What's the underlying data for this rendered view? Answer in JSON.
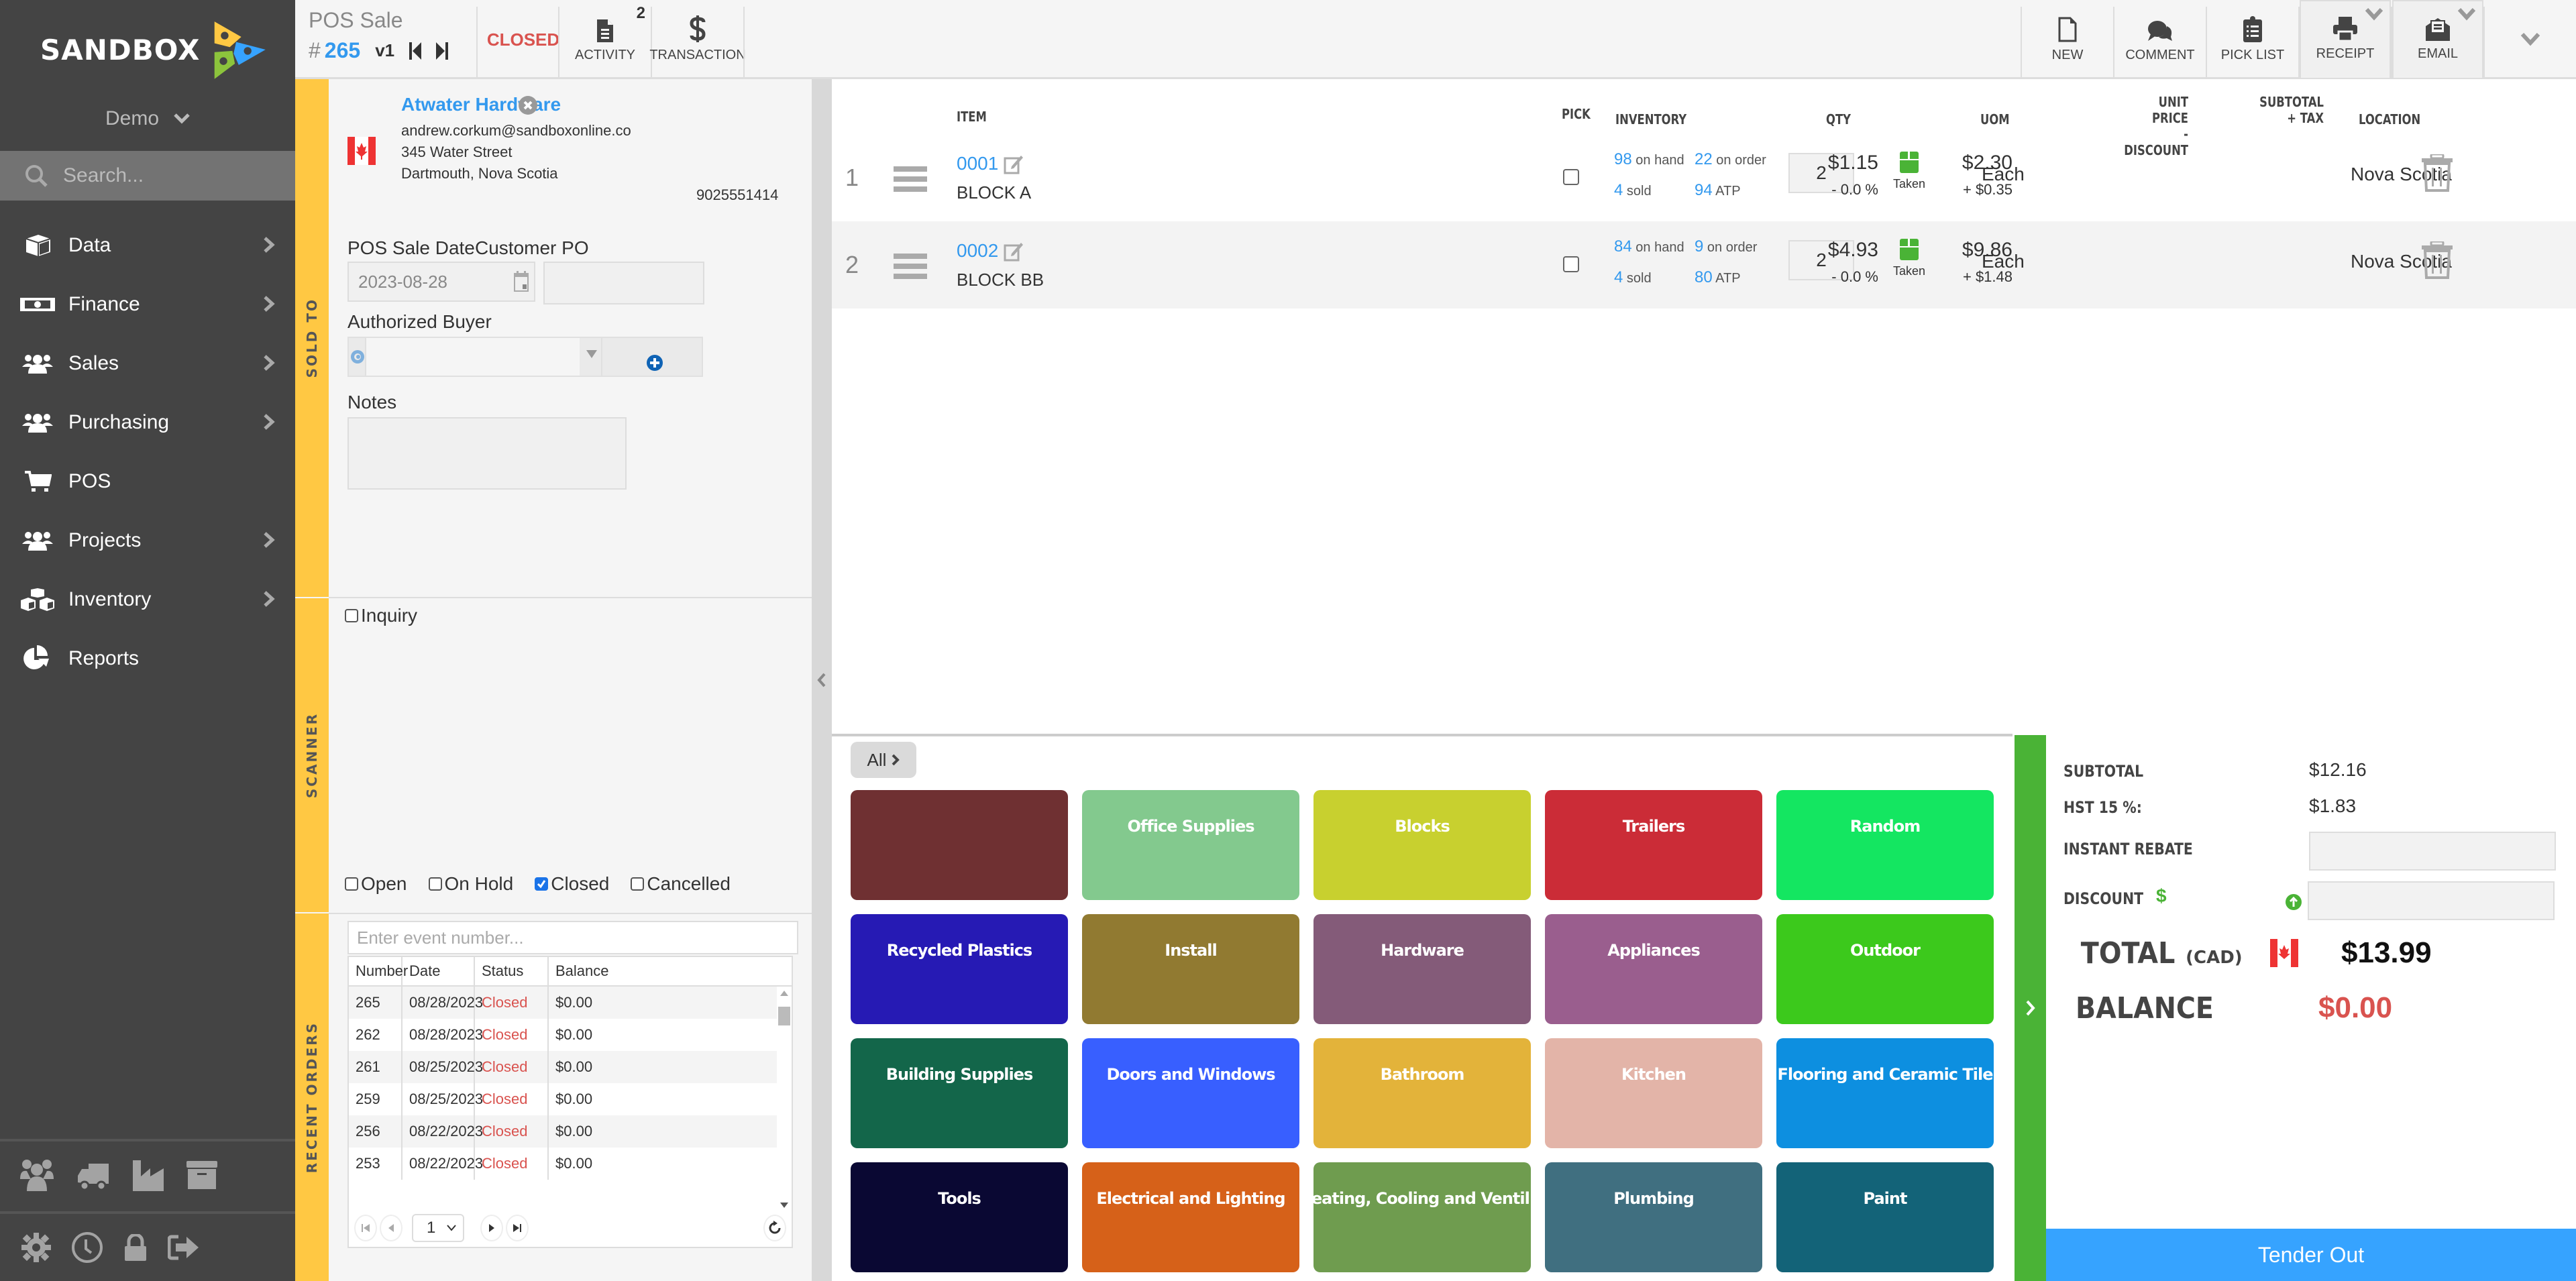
{
  "app": {
    "brand": "SANDBOX",
    "workspace": "Demo"
  },
  "sidebar": {
    "search_placeholder": "Search...",
    "items": [
      {
        "label": "Data",
        "icon": "cube-icon",
        "has_submenu": true
      },
      {
        "label": "Finance",
        "icon": "money-bill-icon",
        "has_submenu": true
      },
      {
        "label": "Sales",
        "icon": "users-icon",
        "has_submenu": true
      },
      {
        "label": "Purchasing",
        "icon": "users-icon",
        "has_submenu": true
      },
      {
        "label": "POS",
        "icon": "cart-icon",
        "has_submenu": false
      },
      {
        "label": "Projects",
        "icon": "users-icon",
        "has_submenu": true
      },
      {
        "label": "Inventory",
        "icon": "cubes-icon",
        "has_submenu": true
      },
      {
        "label": "Reports",
        "icon": "pie-chart-icon",
        "has_submenu": false
      }
    ],
    "tools": [
      "users-icon",
      "truck-icon",
      "factory-icon",
      "archive-icon"
    ],
    "system": [
      "gear-icon",
      "clock-icon",
      "lock-icon",
      "sign-out-icon"
    ]
  },
  "header": {
    "doc_type": "POS Sale",
    "hash": "#",
    "number": "265",
    "version": "v1",
    "status": "CLOSED",
    "buttons_left": [
      {
        "label": "ACTIVITY",
        "badge": "2",
        "icon": "document-icon"
      },
      {
        "label": "TRANSACTION",
        "icon": "dollar-icon"
      }
    ],
    "buttons_right": [
      {
        "label": "NEW",
        "icon": "new-file-icon"
      },
      {
        "label": "COMMENT",
        "icon": "comments-icon"
      },
      {
        "label": "PICK LIST",
        "icon": "clipboard-list-icon"
      },
      {
        "label": "RECEIPT",
        "icon": "printer-icon",
        "dropdown": true
      },
      {
        "label": "EMAIL",
        "icon": "envelope-open-icon",
        "dropdown": true
      }
    ]
  },
  "sold_to": {
    "tab_label": "SOLD TO",
    "customer_name": "Atwater Hardware",
    "email": "andrew.corkum@sandboxonline.co",
    "address1": "345 Water Street",
    "address2": "Dartmouth, Nova Scotia",
    "phone": "9025551414",
    "country_flag": "Canada",
    "sale_date_label": "POS Sale Date",
    "sale_date": "2023-08-28",
    "customer_po_label": "Customer PO",
    "customer_po": "",
    "authorized_buyer_label": "Authorized Buyer",
    "authorized_buyer": "",
    "notes_label": "Notes",
    "notes": ""
  },
  "scanner": {
    "tab_label": "SCANNER",
    "inquiry_label": "Inquiry",
    "inquiry_checked": false
  },
  "status_filters": [
    {
      "label": "Open",
      "checked": false
    },
    {
      "label": "On Hold",
      "checked": false
    },
    {
      "label": "Closed",
      "checked": true
    },
    {
      "label": "Cancelled",
      "checked": false
    }
  ],
  "recent_orders": {
    "tab_label": "RECENT ORDERS",
    "search_placeholder": "Enter event number...",
    "columns": [
      "Number",
      "Date",
      "Status",
      "Balance"
    ],
    "rows": [
      {
        "number": "265",
        "date": "08/28/2023",
        "status": "Closed",
        "balance": "$0.00"
      },
      {
        "number": "262",
        "date": "08/28/2023",
        "status": "Closed",
        "balance": "$0.00"
      },
      {
        "number": "261",
        "date": "08/25/2023",
        "status": "Closed",
        "balance": "$0.00"
      },
      {
        "number": "259",
        "date": "08/25/2023",
        "status": "Closed",
        "balance": "$0.00"
      },
      {
        "number": "256",
        "date": "08/22/2023",
        "status": "Closed",
        "balance": "$0.00"
      },
      {
        "number": "253",
        "date": "08/22/2023",
        "status": "Closed",
        "balance": "$0.00"
      }
    ],
    "page": "1"
  },
  "items_table": {
    "columns": {
      "item": "ITEM",
      "pick": "PICK",
      "inventory": "INVENTORY",
      "qty": "QTY",
      "uom": "UOM",
      "unit_price_1": "UNIT PRICE",
      "unit_price_2": "- DISCOUNT",
      "subtotal_1": "SUBTOTAL",
      "subtotal_2": "+ TAX",
      "location": "LOCATION"
    },
    "inv_labels": {
      "on_hand": "on hand",
      "on_order": "on order",
      "sold": "sold",
      "atp": "ATP"
    },
    "rows": [
      {
        "line": "1",
        "code": "0001",
        "desc": "BLOCK A",
        "on_hand": "98",
        "on_order": "22",
        "sold": "4",
        "atp": "94",
        "qty": "2",
        "pick_status": "Taken",
        "uom": "Each",
        "unit_price": "$1.15",
        "discount": "- 0.0 %",
        "subtotal": "$2.30",
        "tax": "+ $0.35",
        "location": "Nova Scotia"
      },
      {
        "line": "2",
        "code": "0002",
        "desc": "BLOCK BB",
        "on_hand": "84",
        "on_order": "9",
        "sold": "4",
        "atp": "80",
        "qty": "2",
        "pick_status": "Taken",
        "uom": "Each",
        "unit_price": "$4.93",
        "discount": "- 0.0 %",
        "subtotal": "$9.86",
        "tax": "+ $1.48",
        "location": "Nova Scotia"
      }
    ]
  },
  "categories": {
    "breadcrumb": "All",
    "tiles": [
      {
        "label": "",
        "color": "#6f3032"
      },
      {
        "label": "Office Supplies",
        "color": "#83c98e"
      },
      {
        "label": "Blocks",
        "color": "#c8d02f"
      },
      {
        "label": "Trailers",
        "color": "#cb2c37"
      },
      {
        "label": "Random",
        "color": "#14e661"
      },
      {
        "label": "Recycled Plastics",
        "color": "#261ab4"
      },
      {
        "label": "Install",
        "color": "#917a31"
      },
      {
        "label": "Hardware",
        "color": "#845b79"
      },
      {
        "label": "Appliances",
        "color": "#9a5e8e"
      },
      {
        "label": "Outdoor",
        "color": "#3cc91c"
      },
      {
        "label": "Building Supplies",
        "color": "#13664a"
      },
      {
        "label": "Doors and Windows",
        "color": "#385fff"
      },
      {
        "label": "Bathroom",
        "color": "#e3b33a"
      },
      {
        "label": "Kitchen",
        "color": "#e3b4a8"
      },
      {
        "label": "Flooring and Ceramic Tile",
        "color": "#0d8fe0"
      },
      {
        "label": "Tools",
        "color": "#0a0833"
      },
      {
        "label": "Electrical and Lighting",
        "color": "#d66119"
      },
      {
        "label": "Heating, Cooling and Ventil...",
        "color": "#6f9c4f"
      },
      {
        "label": "Plumbing",
        "color": "#406f80"
      },
      {
        "label": "Paint",
        "color": "#136378"
      }
    ]
  },
  "totals": {
    "subtotal_label": "SUBTOTAL",
    "subtotal": "$12.16",
    "tax_label": "HST 15 %:",
    "tax": "$1.83",
    "rebate_label": "INSTANT REBATE",
    "rebate": "",
    "discount_label": "DISCOUNT",
    "discount_symbol": "$",
    "discount": "",
    "total_label": "TOTAL",
    "currency": "(CAD)",
    "total": "$13.99",
    "balance_label": "BALANCE",
    "balance": "$0.00",
    "tender_label": "Tender Out"
  },
  "colors": {
    "accent": "#3399ee",
    "status_closed": "#d9534f",
    "panel_tab": "#ffc843",
    "tender": "#36a3ff",
    "cart_bar": "#4ab336"
  }
}
